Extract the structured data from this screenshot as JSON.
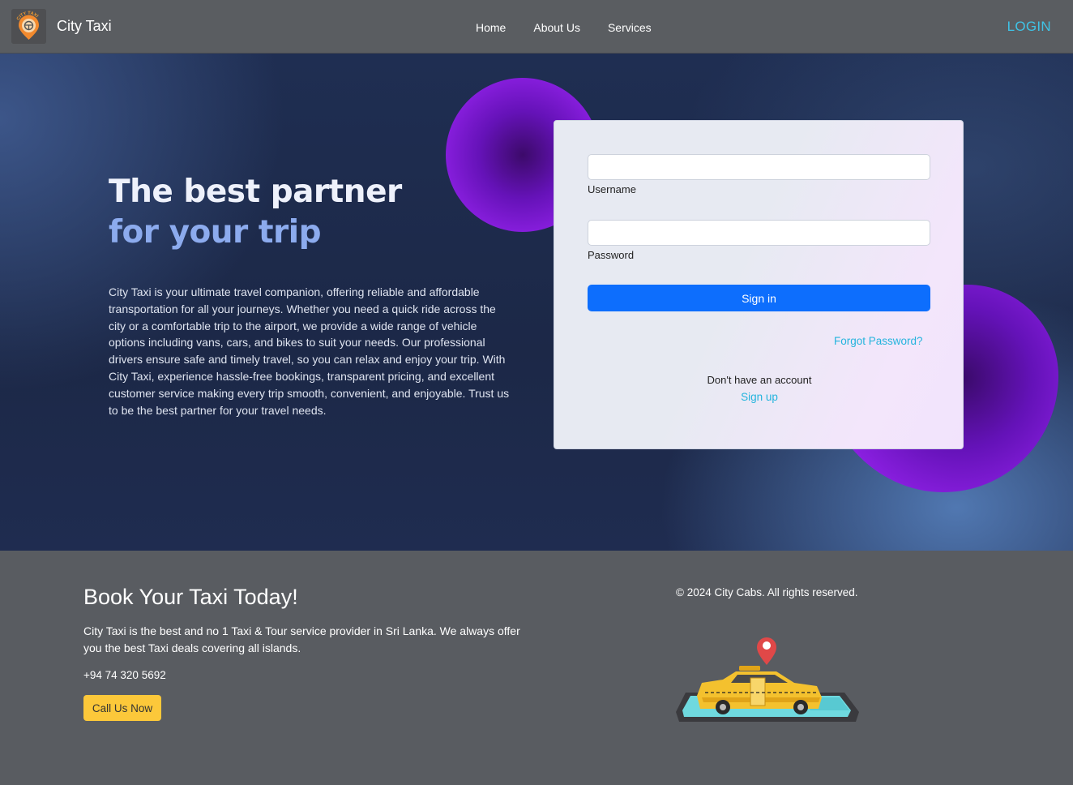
{
  "nav": {
    "brand": "City Taxi",
    "logo_text": "CITY TAXI",
    "links": [
      "Home",
      "About Us",
      "Services"
    ],
    "login": "LOGIN"
  },
  "hero": {
    "title_line1": "The best partner",
    "title_line2": "for your trip",
    "description": "City Taxi is your ultimate travel companion, offering reliable and affordable transportation for all your journeys. Whether you need a quick ride across the city or a comfortable trip to the airport, we provide a wide range of vehicle options including vans, cars, and bikes to suit your needs. Our professional drivers ensure safe and timely travel, so you can relax and enjoy your trip. With City Taxi, experience hassle-free bookings, transparent pricing, and excellent customer service making every trip smooth, convenient, and enjoyable. Trust us to be the best partner for your travel needs."
  },
  "login_form": {
    "username_label": "Username",
    "username_value": "",
    "password_label": "Password",
    "password_value": "",
    "signin_label": "Sign in",
    "forgot_label": "Forgot Password?",
    "no_account_text": "Don't have an account",
    "signup_label": "Sign up"
  },
  "footer": {
    "title": "Book Your Taxi Today!",
    "description": "City Taxi is the best and no 1 Taxi & Tour service provider in Sri Lanka. We always offer you the best Taxi deals covering all islands.",
    "phone": "+94 74 320 5692",
    "call_button": "Call Us Now",
    "copyright": "© 2024 City Cabs. All rights reserved."
  },
  "colors": {
    "accent_link": "#24b4dd",
    "primary_button": "#0d6efd",
    "call_button": "#fcc83a",
    "nav_bg": "#5a5d61"
  },
  "icons": [
    "taxi-logo-icon",
    "map-pin-icon",
    "taxi-car-illustration"
  ]
}
